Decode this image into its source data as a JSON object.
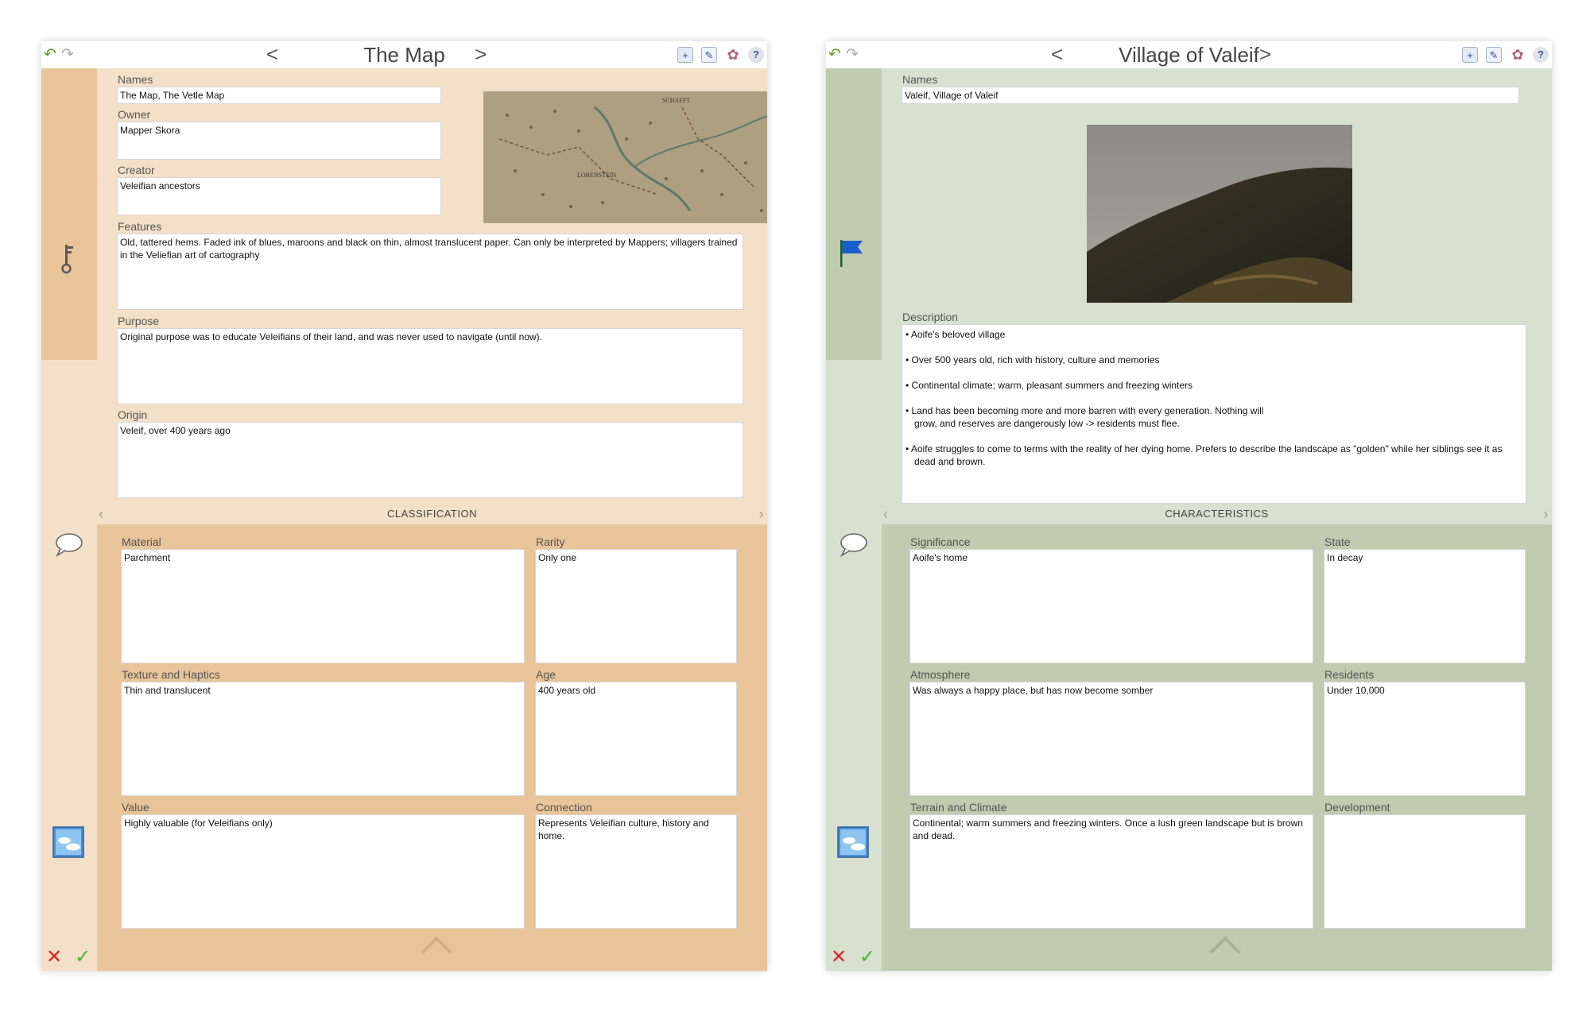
{
  "left": {
    "title": "The Map",
    "fields": {
      "names": {
        "label": "Names",
        "value": "The Map, The Vetle Map"
      },
      "owner": {
        "label": "Owner",
        "value": "Mapper Skora"
      },
      "creator": {
        "label": "Creator",
        "value": "Veleifian ancestors"
      },
      "features": {
        "label": "Features",
        "value": "Old, tattered hems. Faded ink of blues, maroons and black on thin, almost translucent paper. Can only be interpreted by Mappers; villagers trained in the Veliefian art of cartography"
      },
      "purpose": {
        "label": "Purpose",
        "value": "Original purpose was to educate Veleifians of their land, and was never used to navigate (until now)."
      },
      "origin": {
        "label": "Origin",
        "value": "Veleif, over 400 years ago"
      }
    },
    "map_labels": [
      "SCHAFFT",
      "LOBENSTEIN"
    ],
    "section": "CLASSIFICATION",
    "grid": {
      "material": {
        "label": "Material",
        "value": "Parchment"
      },
      "rarity": {
        "label": "Rarity",
        "value": "Only one"
      },
      "texture": {
        "label": "Texture and Haptics",
        "value": "Thin and translucent"
      },
      "age": {
        "label": "Age",
        "value": "400 years old"
      },
      "value": {
        "label": "Value",
        "value": "Highly valuable (for Veleifians only)"
      },
      "connection": {
        "label": "Connection",
        "value": "Represents Veleifian culture, history and home."
      }
    },
    "colors": {
      "sidebar_accent": "#e8c498",
      "background": "#f4e0c8"
    }
  },
  "right": {
    "title": "Village of Valeif",
    "fields": {
      "names": {
        "label": "Names",
        "value": "Valeif, Village of Valeif"
      },
      "description": {
        "label": "Description",
        "bullets": [
          "Aoife's beloved village",
          "Over 500 years old, rich with history, culture and memories",
          "Continental climate; warm, pleasant summers and freezing winters",
          "Land has been becoming more and more barren with every generation. Nothing will grow, and reserves are dangerously low -> residents must flee.",
          "Aoife struggles to come to terms with the reality of her dying home. Prefers to describe the landscape as \"golden\" while her siblings see it as dead and brown."
        ]
      }
    },
    "section": "CHARACTERISTICS",
    "grid": {
      "significance": {
        "label": "Significance",
        "value": "Aoife's home"
      },
      "state": {
        "label": "State",
        "value": "In decay"
      },
      "atmosphere": {
        "label": "Atmosphere",
        "value": "Was always a happy place, but has now become somber"
      },
      "residents": {
        "label": "Residents",
        "value": "Under 10,000"
      },
      "terrain": {
        "label": "Terrain and Climate",
        "value": "Continental; warm summers and freezing winters. Once a lush green landscape but is brown and dead."
      },
      "development": {
        "label": "Development",
        "value": ""
      }
    },
    "colors": {
      "sidebar_accent": "#c0cbb0",
      "background": "#d8e0d0",
      "flag": "#1a5fd0"
    }
  },
  "icons": {
    "undo": "undo-icon",
    "redo": "redo-icon",
    "prev": "chevron-left-icon",
    "next": "chevron-right-icon",
    "add_user": "add-user-icon",
    "edit_note": "edit-note-icon",
    "palette": "palette-icon",
    "help": "help-icon",
    "key": "key-icon",
    "flag": "flag-icon",
    "comment": "speech-bubble-icon",
    "image": "image-icon",
    "cancel": "close-icon",
    "ok": "checkmark-icon",
    "collapse": "chevron-up-icon"
  },
  "glyphs": {
    "undo": "↶",
    "redo": "↷",
    "prev": "<",
    "next": ">",
    "add_user": "+",
    "edit_note": "✎",
    "palette": "✿",
    "help": "?",
    "cancel": "✕",
    "ok": "✓",
    "sec_prev": "‹",
    "sec_next": "›",
    "bullet": "•"
  }
}
